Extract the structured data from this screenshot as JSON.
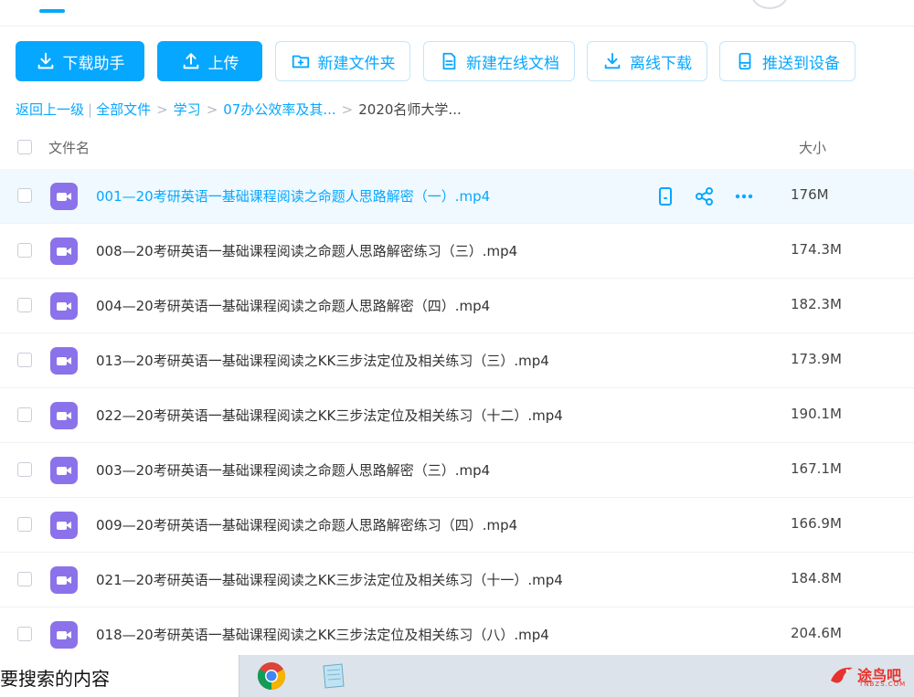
{
  "toolbar": {
    "download_assistant": "下载助手",
    "upload": "上传",
    "new_folder": "新建文件夹",
    "new_online_doc": "新建在线文档",
    "offline_download": "离线下载",
    "push_to_device": "推送到设备"
  },
  "breadcrumb": {
    "back": "返回上一级",
    "separator_bar": "|",
    "items": [
      "全部文件",
      "学习",
      "07办公效率及其...",
      "2020名师大学..."
    ],
    "separator": ">"
  },
  "list_header": {
    "name": "文件名",
    "size": "大小"
  },
  "files": [
    {
      "name": "001—20考研英语一基础课程阅读之命题人思路解密（一）.mp4",
      "size": "176M"
    },
    {
      "name": "008—20考研英语一基础课程阅读之命题人思路解密练习（三）.mp4",
      "size": "174.3M"
    },
    {
      "name": "004—20考研英语一基础课程阅读之命题人思路解密（四）.mp4",
      "size": "182.3M"
    },
    {
      "name": "013—20考研英语一基础课程阅读之KK三步法定位及相关练习（三）.mp4",
      "size": "173.9M"
    },
    {
      "name": "022—20考研英语一基础课程阅读之KK三步法定位及相关练习（十二）.mp4",
      "size": "190.1M"
    },
    {
      "name": "003—20考研英语一基础课程阅读之命题人思路解密（三）.mp4",
      "size": "167.1M"
    },
    {
      "name": "009—20考研英语一基础课程阅读之命题人思路解密练习（四）.mp4",
      "size": "166.9M"
    },
    {
      "name": "021—20考研英语一基础课程阅读之KK三步法定位及相关练习（十一）.mp4",
      "size": "184.8M"
    },
    {
      "name": "018—20考研英语一基础课程阅读之KK三步法定位及相关练习（八）.mp4",
      "size": "204.6M"
    }
  ],
  "taskbar": {
    "search_text": "要搜索的内容",
    "logo_text": "途鸟吧",
    "logo_sub": "TNBZS.COM"
  },
  "colors": {
    "accent": "#06a7ff",
    "video_icon": "#8b72ea",
    "active_row": "#eff9ff"
  }
}
